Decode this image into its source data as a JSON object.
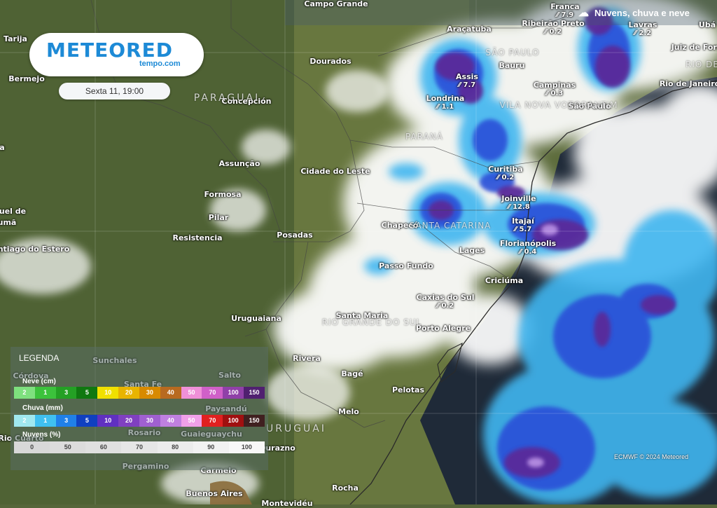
{
  "header": {
    "layer_icon": "cloud-rain-snow-icon",
    "layer_title": "Nuvens, chuva e neve"
  },
  "brand": {
    "name": "METEORED",
    "site": "tempo.com"
  },
  "datetime": "Sexta 11, 19:00",
  "countries": [
    "PARAGUAI",
    "URUGUAI"
  ],
  "regions": [
    "SÃO PAULO",
    "PARANÁ",
    "SANTA CATARINA",
    "RIO GRANDE DO SUL",
    "VILA NOVA VOTORANTIM",
    "RIO DE"
  ],
  "places": [
    {
      "name": "Campo Grande"
    },
    {
      "name": "Araçatuba"
    },
    {
      "name": "Ribeirão Preto",
      "value": "0.2"
    },
    {
      "name": "Franca",
      "value": "7.9"
    },
    {
      "name": "Lavras",
      "value": "2.2"
    },
    {
      "name": "Ubá"
    },
    {
      "name": "Juiz de Fora"
    },
    {
      "name": "Rio de Janeiro"
    },
    {
      "name": "Tarija"
    },
    {
      "name": "Bermejo"
    },
    {
      "name": "Dourados"
    },
    {
      "name": "Bauru"
    },
    {
      "name": "Assis",
      "value": "7.7"
    },
    {
      "name": "Campinas",
      "value": "0.3"
    },
    {
      "name": "São Paulo"
    },
    {
      "name": "Londrina",
      "value": "1.1"
    },
    {
      "name": "Concepción"
    },
    {
      "name": "Assunção"
    },
    {
      "name": "Cidade do Leste"
    },
    {
      "name": "Curitiba",
      "value": "0.2"
    },
    {
      "name": "Formosa"
    },
    {
      "name": "Joinville",
      "value": "12.8"
    },
    {
      "name": "Pilar"
    },
    {
      "name": "Chapecó"
    },
    {
      "name": "Itajaí",
      "value": "5.7"
    },
    {
      "name": "Resistencia"
    },
    {
      "name": "Posadas"
    },
    {
      "name": "Florianópolis",
      "value": "0.4"
    },
    {
      "name": "Lages"
    },
    {
      "name": "ntiago do Estero"
    },
    {
      "name": "Passo Fundo"
    },
    {
      "name": "Criciúma"
    },
    {
      "name": "Caxias do Sul",
      "value": "0.2"
    },
    {
      "name": "Santa Maria"
    },
    {
      "name": "Uruguaiana"
    },
    {
      "name": "Porto Alegre"
    },
    {
      "name": "Sunchales"
    },
    {
      "name": "Rivera"
    },
    {
      "name": "Córdova"
    },
    {
      "name": "Santa Fe"
    },
    {
      "name": "Salto"
    },
    {
      "name": "Bagé"
    },
    {
      "name": "Pelotas"
    },
    {
      "name": "Paysandú"
    },
    {
      "name": "Melo"
    },
    {
      "name": "Rosario"
    },
    {
      "name": "Guaieguaychu"
    },
    {
      "name": "Rio Cuarto"
    },
    {
      "name": "Durazno"
    },
    {
      "name": "Pergamino"
    },
    {
      "name": "Carmelo"
    },
    {
      "name": "Rocha"
    },
    {
      "name": "Buenos Aires"
    },
    {
      "name": "Montevidéu"
    },
    {
      "name": "uel de"
    },
    {
      "name": "umã"
    },
    {
      "name": "a"
    }
  ],
  "legend": {
    "title": "LEGENDA",
    "snow": {
      "label": "Neve (cm)",
      "values": [
        "2",
        "1",
        "3",
        "5",
        "10",
        "20",
        "30",
        "40",
        "50",
        "70",
        "100",
        "150"
      ],
      "colors": [
        "#7ee07e",
        "#3cc23c",
        "#24a024",
        "#107810",
        "#f0e000",
        "#e8b400",
        "#d88a00",
        "#b86a20",
        "#f090d8",
        "#d060c8",
        "#9040a8",
        "#502070"
      ]
    },
    "rain": {
      "label": "Chuva (mm)",
      "values": [
        "2",
        "1",
        "3",
        "5",
        "10",
        "20",
        "30",
        "40",
        "50",
        "70",
        "100",
        "150"
      ],
      "colors": [
        "#a0e8f0",
        "#40c0f0",
        "#2080e8",
        "#1040c0",
        "#6030c0",
        "#8040c0",
        "#a060d0",
        "#c080e0",
        "#f0a0e8",
        "#e02020",
        "#a01010",
        "#402020"
      ]
    },
    "clouds": {
      "label": "Nuvens (%)",
      "values": [
        "0",
        "50",
        "60",
        "70",
        "80",
        "90",
        "100"
      ],
      "colors": [
        "#d8d8d8",
        "#dcdcdc",
        "#e0e0e0",
        "#e6e6e6",
        "#ececec",
        "#f2f2f2",
        "#f8f8f8"
      ]
    }
  },
  "attribution": "ECMWF © 2024 Meteored",
  "precip_marker": "rain-drops-icon"
}
